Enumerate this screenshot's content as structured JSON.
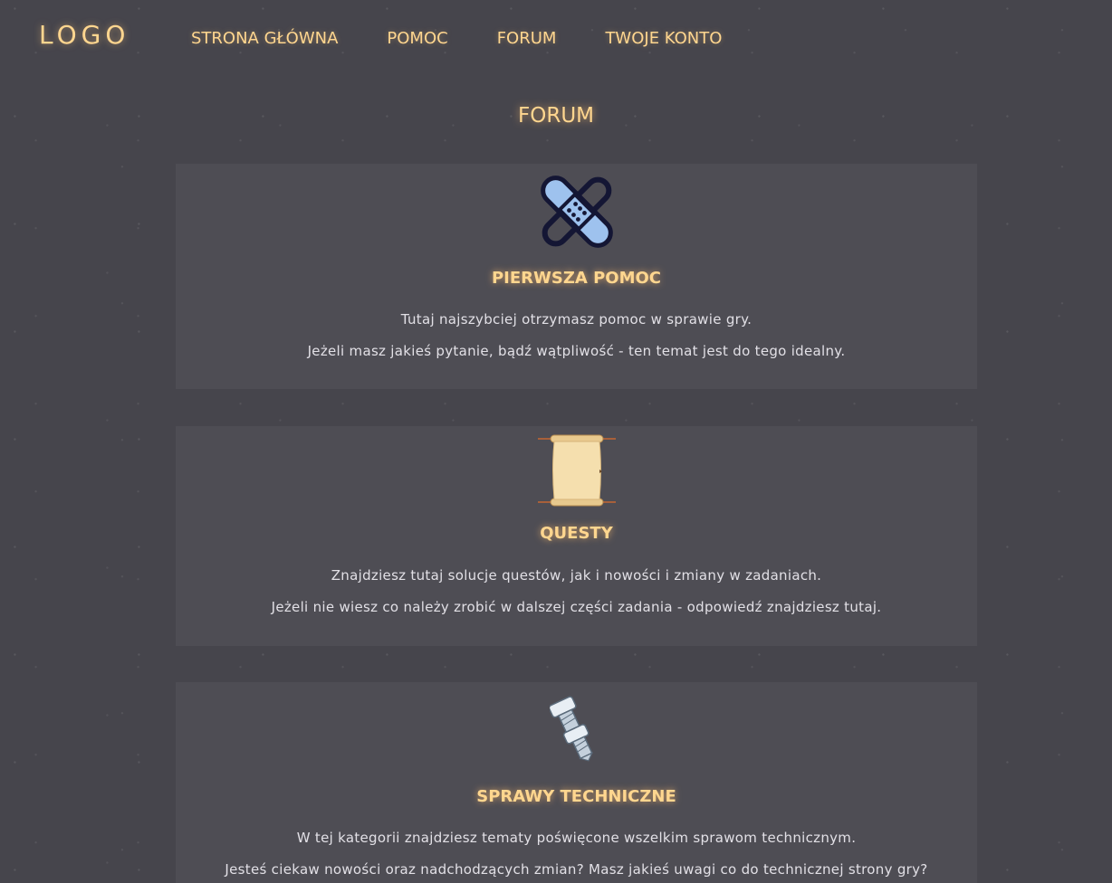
{
  "header": {
    "logo": "LOGO",
    "nav": [
      {
        "label": "STRONA GŁÓWNA"
      },
      {
        "label": "POMOC"
      },
      {
        "label": "FORUM"
      },
      {
        "label": "TWOJE KONTO"
      }
    ]
  },
  "main": {
    "title": "FORUM",
    "categories": [
      {
        "icon": "bandage-icon",
        "title": "PIERWSZA POMOC",
        "line1": "Tutaj najszybciej otrzymasz pomoc w sprawie gry.",
        "line2": "Jeżeli masz jakieś pytanie, bądź wątpliwość - ten temat jest do tego idealny."
      },
      {
        "icon": "scroll-icon",
        "title": "QUESTY",
        "line1": "Znajdziesz tutaj solucje questów, jak i nowości i zmiany w zadaniach.",
        "line2": "Jeżeli nie wiesz co należy zrobić w dalszej części zadania - odpowiedź znajdziesz tutaj."
      },
      {
        "icon": "bolts-icon",
        "title": "SPRAWY TECHNICZNE",
        "line1": "W tej kategorii znajdziesz tematy poświęcone wszelkim sprawom technicznym.",
        "line2": "Jesteś ciekaw nowości oraz nadchodzących zmian? Masz jakieś uwagi co do technicznej strony gry?"
      }
    ]
  },
  "colors": {
    "background": "#46454c",
    "card": "#4e4d54",
    "accent": "#ffd68f",
    "text": "#e2e0e6"
  }
}
